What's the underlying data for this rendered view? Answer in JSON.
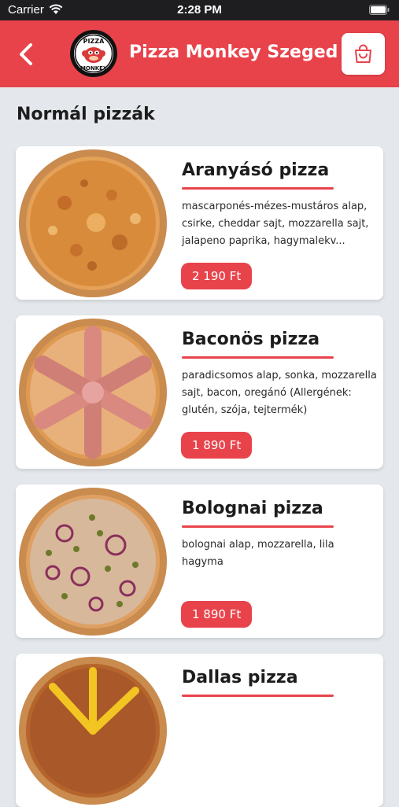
{
  "status_bar": {
    "carrier": "Carrier",
    "time": "2:28 PM"
  },
  "header": {
    "title": "Pizza Monkey Szeged",
    "logo_text_top": "PIZZA",
    "logo_text_bottom": "MONKEY"
  },
  "section": {
    "title": "Normál pizzák"
  },
  "colors": {
    "accent": "#e8434b",
    "background": "#e4e8ec"
  },
  "products": [
    {
      "name": "Aranyásó pizza",
      "description": "mascarponés-mézes-mustáros alap, csirke, cheddar sajt, mozzarella sajt, jalapeno paprika, hagymalekv...",
      "price": "2 190 Ft"
    },
    {
      "name": "Baconös pizza",
      "description": "paradicsomos alap, sonka, mozzarella sajt, bacon, oregánó (Allergének: glutén, szója, tejtermék)",
      "price": "1 890 Ft"
    },
    {
      "name": "Bolognai pizza",
      "description": "bolognai alap, mozzarella, lila hagyma",
      "price": "1 890 Ft"
    },
    {
      "name": "Dallas pizza",
      "description": "",
      "price": ""
    }
  ]
}
